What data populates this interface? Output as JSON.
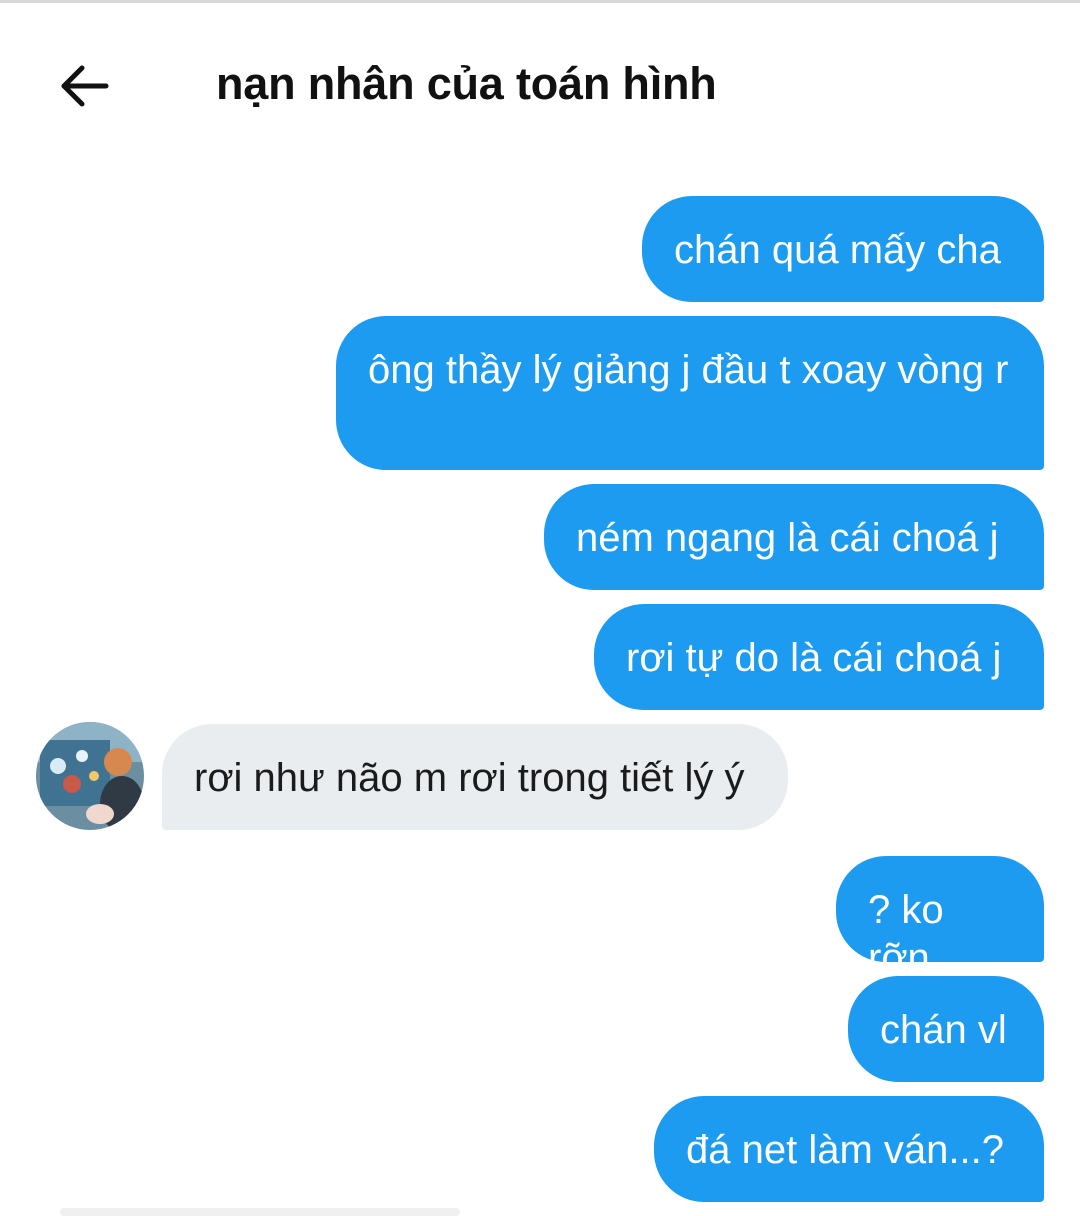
{
  "header": {
    "title": "nạn nhân của toán hình",
    "back_icon": "arrow-left-icon"
  },
  "colors": {
    "outgoing_bubble": "#1d9bf0",
    "incoming_bubble": "#e9edf0",
    "outgoing_text": "#ffffff",
    "incoming_text": "#1b1b1b"
  },
  "messages": [
    {
      "direction": "out",
      "text": "chán quá mấy cha"
    },
    {
      "direction": "out",
      "text": "ông thầy lý giảng j đầu t xoay vòng r"
    },
    {
      "direction": "out",
      "text": "ném ngang là cái choá j"
    },
    {
      "direction": "out",
      "text": "rơi tự do là cái choá j"
    },
    {
      "direction": "in",
      "text": "rơi như não m rơi trong tiết lý ý"
    },
    {
      "direction": "out",
      "text": "? ko rỡn"
    },
    {
      "direction": "out",
      "text": "chán vl"
    },
    {
      "direction": "out",
      "text": "đá net làm ván...?"
    }
  ]
}
